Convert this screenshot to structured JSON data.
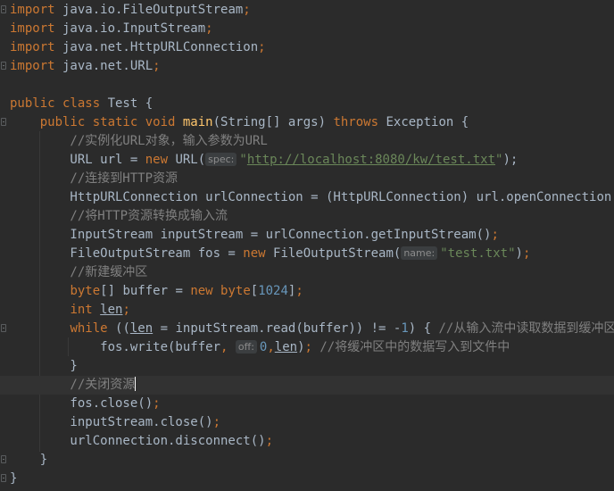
{
  "editor": {
    "lines": [
      {
        "l": [
          [
            "import",
            "kw"
          ],
          [
            " java.io.FileOutputStream",
            "plain"
          ],
          [
            ";",
            "kw"
          ]
        ],
        "fold": true
      },
      {
        "l": [
          [
            "import",
            "kw"
          ],
          [
            " java.io.InputStream",
            "plain"
          ],
          [
            ";",
            "kw"
          ]
        ]
      },
      {
        "l": [
          [
            "import",
            "kw"
          ],
          [
            " java.net.HttpURLConnection",
            "plain"
          ],
          [
            ";",
            "kw"
          ]
        ]
      },
      {
        "l": [
          [
            "import",
            "kw"
          ],
          [
            " java.net.URL",
            "plain"
          ],
          [
            ";",
            "kw"
          ]
        ],
        "fold": true
      },
      {
        "l": []
      },
      {
        "l": [
          [
            "public class ",
            "kw"
          ],
          [
            "Test {",
            "plain"
          ]
        ]
      },
      {
        "l": [
          [
            "    public static void ",
            "kw"
          ],
          [
            "main",
            "fn"
          ],
          [
            "(String[] args) ",
            "plain"
          ],
          [
            "throws ",
            "kw"
          ],
          [
            "Exception {",
            "plain"
          ]
        ],
        "fold": true
      },
      {
        "l": [
          [
            "        //实例化URL对象，输入参数为URL",
            "cmt"
          ]
        ]
      },
      {
        "l": [
          [
            "        URL url = ",
            "plain"
          ],
          [
            "new ",
            "kw"
          ],
          [
            "URL(",
            "plain"
          ],
          [
            "spec:",
            "hint"
          ],
          [
            "\"",
            "str"
          ],
          [
            "http://localhost:8080/kw/test.txt",
            "url"
          ],
          [
            "\"",
            "str"
          ],
          [
            ");",
            "plain"
          ]
        ]
      },
      {
        "l": [
          [
            "        //连接到HTTP资源",
            "cmt"
          ]
        ]
      },
      {
        "l": [
          [
            "        HttpURLConnection urlConnection = (HttpURLConnection) url.openConnection()",
            "plain"
          ],
          [
            ";",
            "kw"
          ]
        ]
      },
      {
        "l": [
          [
            "        //将HTTP资源转换成输入流",
            "cmt"
          ]
        ]
      },
      {
        "l": [
          [
            "        InputStream inputStream = urlConnection.getInputStream()",
            "plain"
          ],
          [
            ";",
            "kw"
          ]
        ]
      },
      {
        "l": [
          [
            "        FileOutputStream fos = ",
            "plain"
          ],
          [
            "new ",
            "kw"
          ],
          [
            "FileOutputStream(",
            "plain"
          ],
          [
            "name:",
            "hint"
          ],
          [
            "\"test.txt\"",
            "str"
          ],
          [
            ")",
            "plain"
          ],
          [
            ";",
            "kw"
          ]
        ]
      },
      {
        "l": [
          [
            "        //新建缓冲区",
            "cmt"
          ]
        ]
      },
      {
        "l": [
          [
            "        ",
            "plain"
          ],
          [
            "byte",
            "kw"
          ],
          [
            "[] buffer = ",
            "plain"
          ],
          [
            "new byte",
            "kw"
          ],
          [
            "[",
            "plain"
          ],
          [
            "1024",
            "num"
          ],
          [
            "]",
            "plain"
          ],
          [
            ";",
            "kw"
          ]
        ]
      },
      {
        "l": [
          [
            "        ",
            "plain"
          ],
          [
            "int ",
            "kw"
          ],
          [
            "len",
            "var"
          ],
          [
            ";",
            "kw"
          ]
        ]
      },
      {
        "l": [
          [
            "        ",
            "plain"
          ],
          [
            "while ",
            "kw"
          ],
          [
            "((",
            "plain"
          ],
          [
            "len",
            "var"
          ],
          [
            " = inputStream.read(buffer)) != -",
            "plain"
          ],
          [
            "1",
            "num"
          ],
          [
            ") { ",
            "plain"
          ],
          [
            "//从输入流中读取数据到缓冲区中",
            "cmt"
          ]
        ],
        "fold": true
      },
      {
        "l": [
          [
            "            fos.write(buffer",
            "plain"
          ],
          [
            ",",
            "kw"
          ],
          [
            " ",
            "plain"
          ],
          [
            "off:",
            "hint"
          ],
          [
            "0",
            "num"
          ],
          [
            ",",
            "kw"
          ],
          [
            "len",
            "var"
          ],
          [
            ")",
            "plain"
          ],
          [
            "; ",
            "kw"
          ],
          [
            "//将缓冲区中的数据写入到文件中",
            "cmt"
          ]
        ]
      },
      {
        "l": [
          [
            "        }",
            "plain"
          ]
        ]
      },
      {
        "l": [
          [
            "        //关闭资源",
            "cmt"
          ],
          [
            "",
            "caret"
          ]
        ],
        "current": true
      },
      {
        "l": [
          [
            "        fos.close()",
            "plain"
          ],
          [
            ";",
            "kw"
          ]
        ]
      },
      {
        "l": [
          [
            "        inputStream.close()",
            "plain"
          ],
          [
            ";",
            "kw"
          ]
        ]
      },
      {
        "l": [
          [
            "        urlConnection.disconnect()",
            "plain"
          ],
          [
            ";",
            "kw"
          ]
        ]
      },
      {
        "l": [
          [
            "    }",
            "plain"
          ]
        ],
        "fold": true
      },
      {
        "l": [
          [
            "}",
            "plain"
          ]
        ],
        "fold": true
      }
    ]
  }
}
